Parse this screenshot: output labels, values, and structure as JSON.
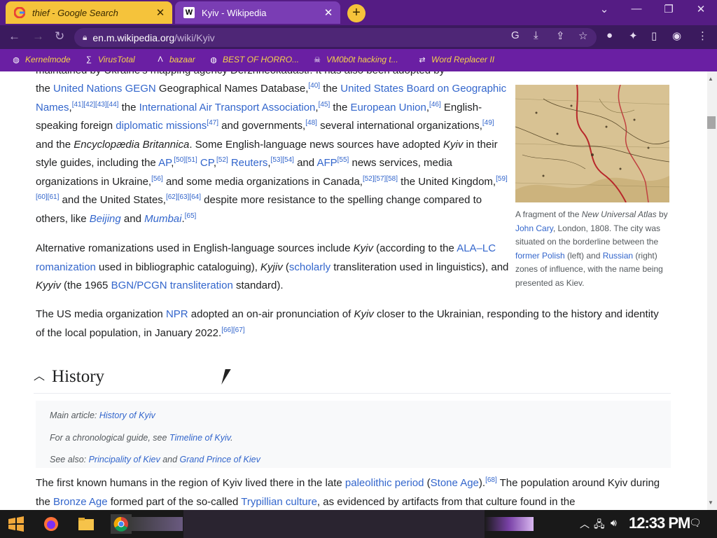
{
  "browser": {
    "tabs": [
      {
        "title": "thief - Google Search",
        "favicon": "G",
        "active": false
      },
      {
        "title": "Kyiv - Wikipedia",
        "favicon": "W",
        "active": true
      }
    ],
    "url_host": "en.m.wikipedia.org",
    "url_path": "/wiki/Kyiv",
    "bookmarks": [
      {
        "label": "Kernelmode",
        "icon": "globe-icon"
      },
      {
        "label": "VirusTotal",
        "icon": "virustotal-icon"
      },
      {
        "label": "bazaar",
        "icon": "bazaar-icon"
      },
      {
        "label": "BEST OF HORRO...",
        "icon": "globe-icon"
      },
      {
        "label": "VM0b0t hacking t...",
        "icon": "skull-icon"
      },
      {
        "label": "Word Replacer II",
        "icon": "replacer-icon"
      }
    ],
    "colors": {
      "tab_active": "#7a3db4",
      "tab_inactive": "#f5c33b",
      "toolbar": "#3b1a5e",
      "bookmark_bar": "#6a1fa3",
      "link": "#3366cc"
    }
  },
  "article": {
    "cutoff_line": "maintained by Ukraine's mapping agency Derzhheokadastr. It has also been adopted by",
    "p1": [
      {
        "t": "the "
      },
      {
        "a": "United Nations GEGN"
      },
      {
        "t": " Geographical Names Database,"
      },
      {
        "s": "[40]"
      },
      {
        "t": " the "
      },
      {
        "a": "United States Board on Geographic Names"
      },
      {
        "t": ","
      },
      {
        "s": "[41][42][43][44]"
      },
      {
        "t": " the "
      },
      {
        "a": "International Air Transport Association"
      },
      {
        "t": ","
      },
      {
        "s": "[45]"
      },
      {
        "t": " the "
      },
      {
        "a": "European Union"
      },
      {
        "t": ","
      },
      {
        "s": "[46]"
      },
      {
        "t": " English-speaking foreign "
      },
      {
        "a": "diplomatic missions"
      },
      {
        "s": "[47]"
      },
      {
        "t": " and governments,"
      },
      {
        "s": "[48]"
      },
      {
        "t": " several international organizations,"
      },
      {
        "s": "[49]"
      },
      {
        "t": " and the "
      },
      {
        "i": "Encyclopædia Britannica"
      },
      {
        "t": ". Some English-language news sources have adopted "
      },
      {
        "i": "Kyiv"
      },
      {
        "t": " in their style guides, including the "
      },
      {
        "a": "AP"
      },
      {
        "t": ","
      },
      {
        "s": "[50][51]"
      },
      {
        "t": " "
      },
      {
        "a": "CP"
      },
      {
        "t": ","
      },
      {
        "s": "[52]"
      },
      {
        "t": " "
      },
      {
        "a": "Reuters"
      },
      {
        "t": ","
      },
      {
        "s": "[53][54]"
      },
      {
        "t": " and "
      },
      {
        "a": "AFP"
      },
      {
        "s": "[55]"
      },
      {
        "t": " news services, media organizations in Ukraine,"
      },
      {
        "s": "[56]"
      },
      {
        "t": " and some media organizations in Canada,"
      },
      {
        "s": "[52][57][58]"
      },
      {
        "t": " the United Kingdom,"
      },
      {
        "s": "[59][60][61]"
      },
      {
        "t": " and the United States,"
      },
      {
        "s": "[62][63][64]"
      },
      {
        "t": " despite more resistance to the spelling change compared to others, like "
      },
      {
        "ai": "Beijing"
      },
      {
        "t": " and "
      },
      {
        "ai": "Mumbai"
      },
      {
        "t": "."
      },
      {
        "s": "[65]"
      }
    ],
    "p2": [
      {
        "t": "Alternative romanizations used in English-language sources include "
      },
      {
        "i": "Kyiv"
      },
      {
        "t": " (according to the "
      },
      {
        "a": "ALA–LC romanization"
      },
      {
        "t": " used in bibliographic cataloguing), "
      },
      {
        "i": "Kyjiv"
      },
      {
        "t": " ("
      },
      {
        "a": "scholarly"
      },
      {
        "t": " transliteration used in linguistics), and "
      },
      {
        "i": "Kyyiv"
      },
      {
        "t": " (the 1965 "
      },
      {
        "a": "BGN/PCGN transliteration"
      },
      {
        "t": " standard)."
      }
    ],
    "p3": [
      {
        "t": "The US media organization "
      },
      {
        "a": "NPR"
      },
      {
        "t": " adopted an on-air pronunciation of "
      },
      {
        "i": "Kyiv"
      },
      {
        "t": " closer to the Ukrainian, responding to the history and identity of the local population, in January 2022."
      },
      {
        "s": "[66][67]"
      }
    ],
    "figure_caption": [
      {
        "t": "A fragment of the "
      },
      {
        "i": "New Universal Atlas"
      },
      {
        "t": " by "
      },
      {
        "a": "John Cary"
      },
      {
        "t": ", London, 1808. The city was situated on the borderline between the "
      },
      {
        "a": "former Polish"
      },
      {
        "t": " (left) and "
      },
      {
        "a": "Russian"
      },
      {
        "t": " (right) zones of influence, with the name being presented as Kiev."
      }
    ],
    "section_title": "History",
    "hatnotes": [
      [
        {
          "t": "Main article: "
        },
        {
          "a": "History of Kyiv"
        }
      ],
      [
        {
          "t": "For a chronological guide, see "
        },
        {
          "a": "Timeline of Kyiv"
        },
        {
          "t": "."
        }
      ],
      [
        {
          "t": "See also: "
        },
        {
          "a": "Principality of Kiev"
        },
        {
          "t": " and "
        },
        {
          "a": "Grand Prince of Kiev"
        }
      ]
    ],
    "p4": [
      {
        "t": "The first known humans in the region of Kyiv lived there in the late "
      },
      {
        "a": "paleolithic period"
      },
      {
        "t": " ("
      },
      {
        "a": "Stone Age"
      },
      {
        "t": ")."
      },
      {
        "s": "[68]"
      },
      {
        "t": " The population around Kyiv during the "
      },
      {
        "a": "Bronze Age"
      },
      {
        "t": " formed part of the so-called "
      },
      {
        "a": "Trypillian culture"
      },
      {
        "t": ", as evidenced by artifacts from that culture found in the"
      }
    ]
  },
  "taskbar": {
    "clock": "12:33 PM",
    "apps": [
      "start-icon",
      "firefox-icon",
      "file-explorer-icon",
      "chrome-icon"
    ]
  }
}
